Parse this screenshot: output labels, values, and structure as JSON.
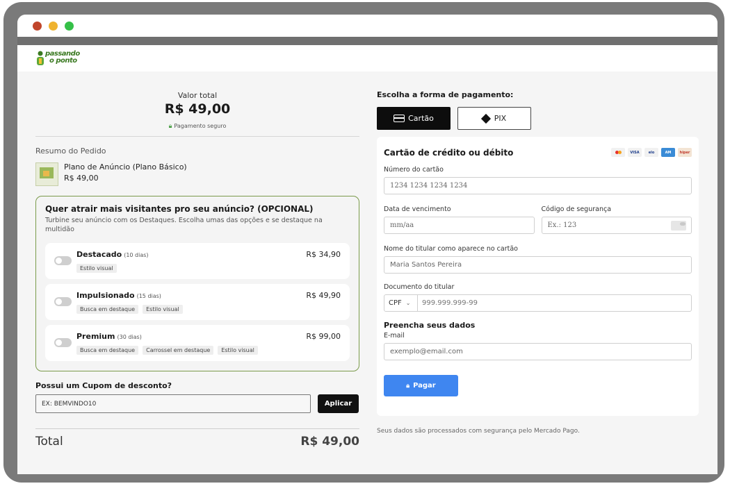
{
  "window": {
    "dots": [
      "close",
      "minimize",
      "maximize"
    ]
  },
  "logo": {
    "line1": "passando",
    "line2": "o ponto"
  },
  "summary": {
    "total_label": "Valor total",
    "total_value": "R$ 49,00",
    "secure_label": "Pagamento seguro",
    "order_title": "Resumo do Pedido",
    "product_name": "Plano de Anúncio (Plano Básico)",
    "product_price": "R$ 49,00"
  },
  "optional": {
    "title": "Quer atrair mais visitantes pro seu anúncio? (OPCIONAL)",
    "subtitle": "Turbine seu anúncio com os Destaques. Escolha umas das opções e se destaque na multidão",
    "options": [
      {
        "name": "Destacado",
        "days": "(10 dias)",
        "price": "R$ 34,90",
        "tags": [
          "Estilo visual"
        ],
        "enabled": false
      },
      {
        "name": "Impulsionado",
        "days": "(15 dias)",
        "price": "R$ 49,90",
        "tags": [
          "Busca em destaque",
          "Estilo visual"
        ],
        "enabled": false
      },
      {
        "name": "Premium",
        "days": "(30 dias)",
        "price": "R$ 99,00",
        "tags": [
          "Busca em destaque",
          "Carrossel em destaque",
          "Estilo visual"
        ],
        "enabled": false
      }
    ]
  },
  "coupon": {
    "label": "Possui um Cupom de desconto?",
    "placeholder": "EX: BEMVINDO10",
    "apply_label": "Aplicar"
  },
  "grand_total": {
    "label": "Total",
    "value": "R$ 49,00"
  },
  "payment": {
    "title": "Escolha a forma de pagamento:",
    "tabs": [
      {
        "label": "Cartão",
        "active": true
      },
      {
        "label": "PIX",
        "active": false
      }
    ],
    "card_title": "Cartão de crédito ou débito",
    "brands": [
      "mastercard",
      "visa",
      "elo",
      "amex",
      "hipercard"
    ],
    "brand_labels": {
      "visa": "VISA",
      "elo": "elo",
      "amex": "AM",
      "hipercard": "hiper"
    },
    "card_number_label": "Número do cartão",
    "card_number_placeholder": "1234 1234 1234 1234",
    "expiry_label": "Data de vencimento",
    "expiry_placeholder": "mm/aa",
    "cvv_label": "Código de segurança",
    "cvv_placeholder": "Ex.: 123",
    "holder_label": "Nome do titular como aparece no cartão",
    "holder_value": "Maria Santos Pereira",
    "doc_label": "Documento do titular",
    "doc_type": "CPF",
    "doc_placeholder": "999.999.999-99",
    "fill_title": "Preencha seus dados",
    "email_label": "E-mail",
    "email_placeholder": "exemplo@email.com",
    "pay_label": "Pagar",
    "footer_note": "Seus dados são processados com segurança pelo Mercado Pago."
  },
  "colors": {
    "accent": "#3f86f0",
    "optional_border": "#7a9a4a",
    "dark": "#0d0d0d"
  }
}
